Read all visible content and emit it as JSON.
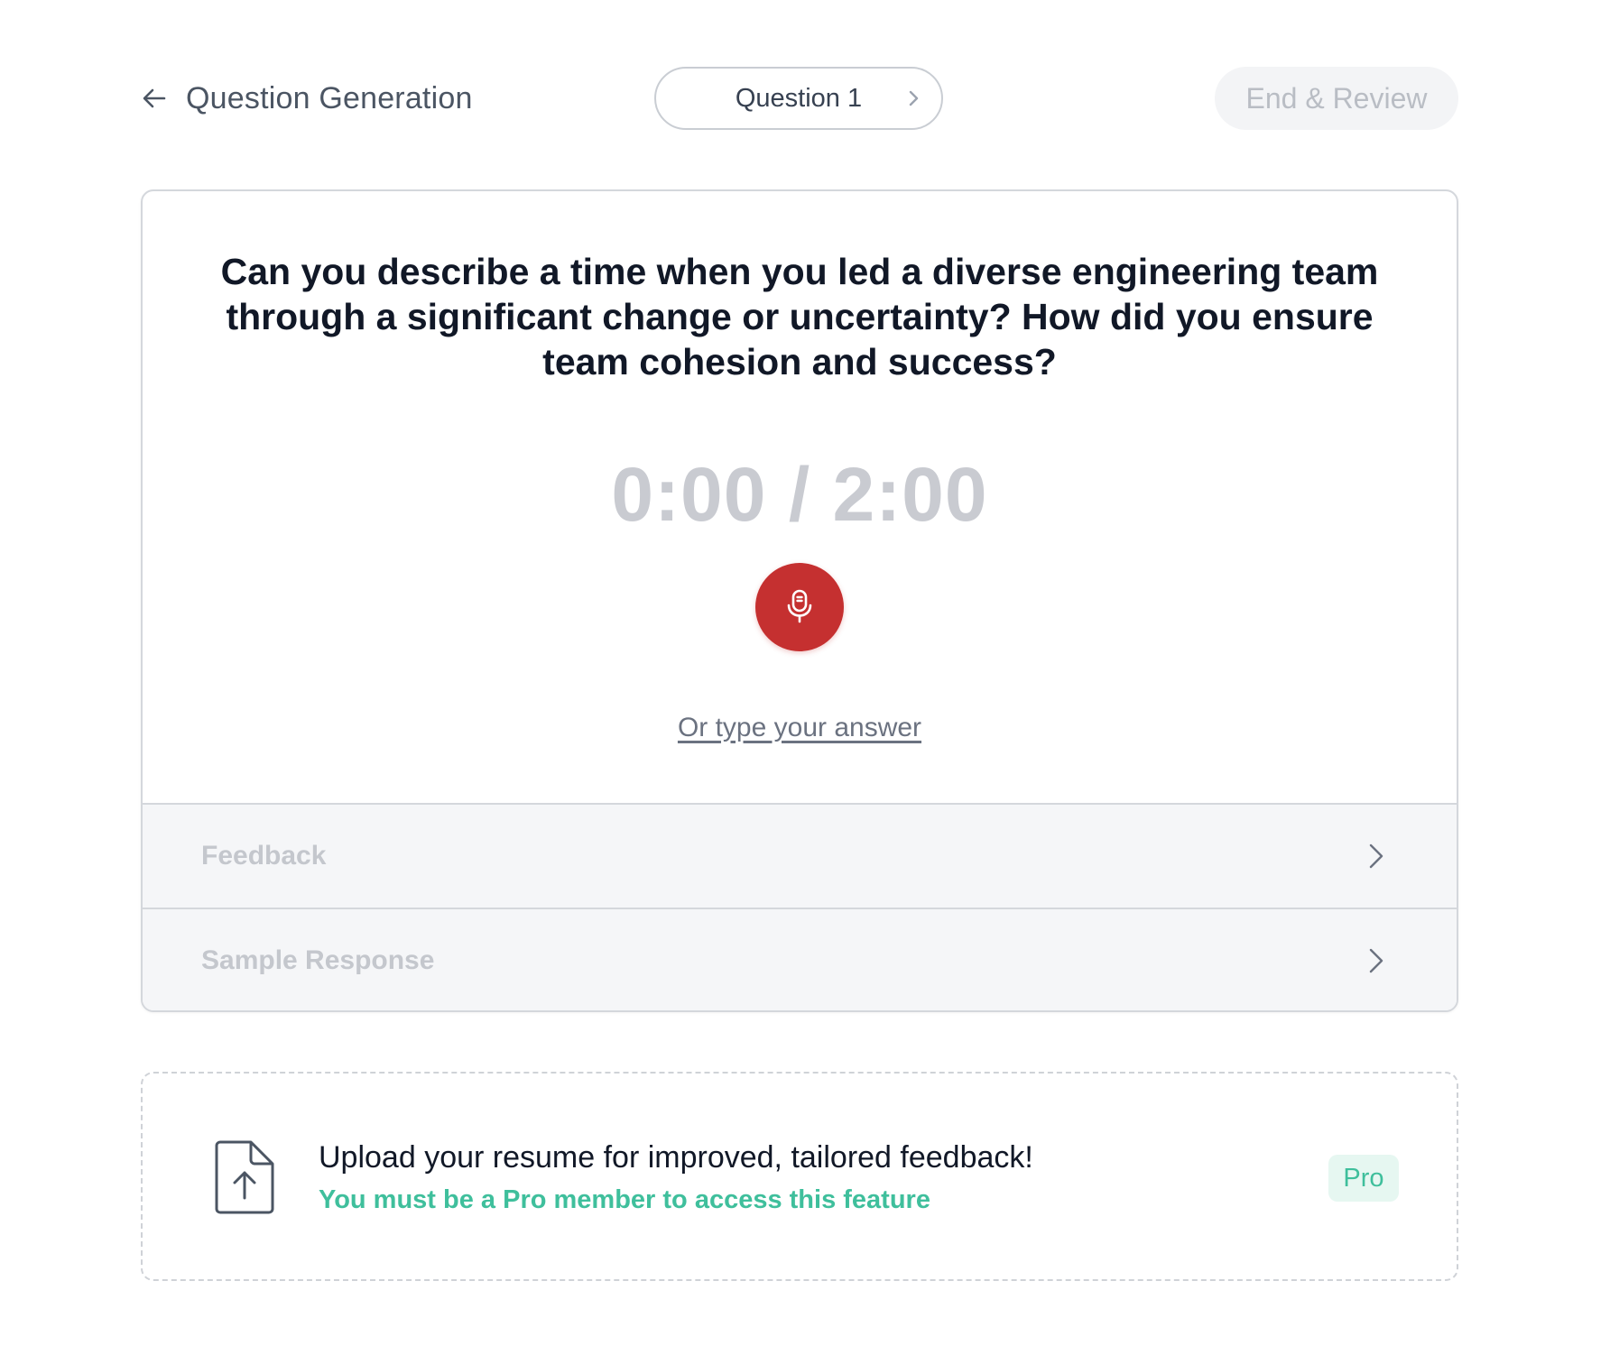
{
  "header": {
    "back_label": "Question Generation",
    "question_pill_label": "Question 1",
    "end_review_label": "End & Review"
  },
  "question": {
    "text": "Can you describe a time when you led a diverse engineering team through a significant change or uncertainty? How did you ensure team cohesion and success?",
    "timer": "0:00 / 2:00",
    "type_answer_label": "Or type your answer"
  },
  "accordions": [
    {
      "label": "Feedback"
    },
    {
      "label": "Sample Response"
    }
  ],
  "upload": {
    "title": "Upload your resume for improved, tailored feedback!",
    "subtitle": "You must be a Pro member to access this feature",
    "badge": "Pro"
  },
  "icons": {
    "back": "arrow-left-icon",
    "next": "chevron-right-icon",
    "mic": "microphone-icon",
    "upload": "file-upload-icon"
  },
  "colors": {
    "mic_red": "#c53030",
    "pro_green": "#3fbf9c",
    "pro_badge_bg": "#e6f7f1",
    "timer_gray": "#c9cbd1",
    "panel_bg": "#f5f6f8"
  }
}
